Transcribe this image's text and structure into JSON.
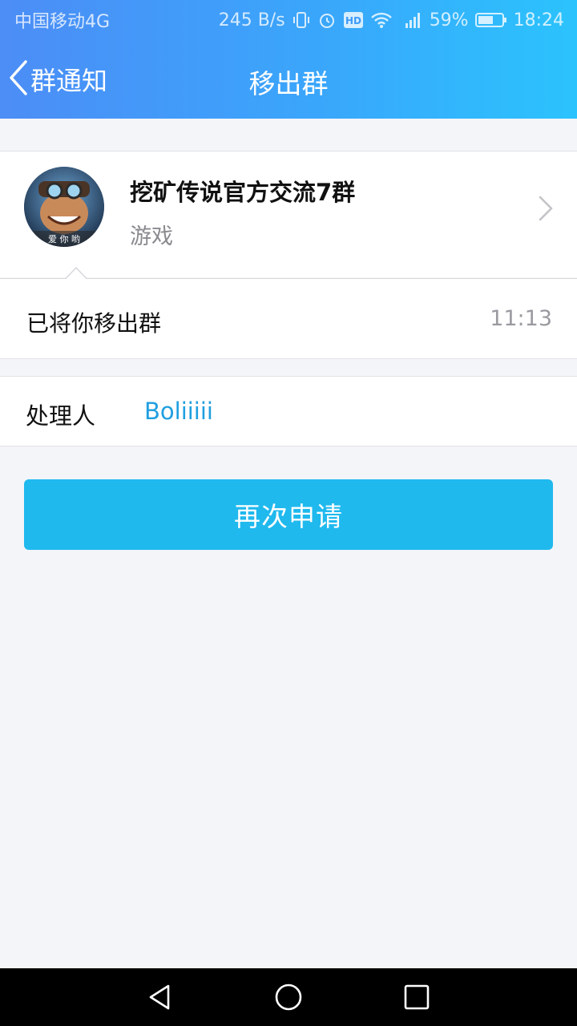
{
  "status_bar": {
    "carrier": "中国移动4G",
    "net_speed": "245 B/s",
    "battery": "59%",
    "time": "18:24",
    "icons": [
      "vibrate-icon",
      "alarm-icon",
      "hd-icon",
      "wifi-icon",
      "signal-4g-icon",
      "battery-icon"
    ]
  },
  "nav": {
    "back_label": "群通知",
    "title": "移出群"
  },
  "group": {
    "name": "挖矿传说官方交流7群",
    "category": "游戏",
    "avatar_caption": "爱 你 哟"
  },
  "message": {
    "text": "已将你移出群",
    "time": "11:13"
  },
  "handler": {
    "label": "处理人",
    "name": "Boliiiii"
  },
  "action": {
    "reapply_label": "再次申请"
  },
  "colors": {
    "header_start": "#4c8df6",
    "header_end": "#2bc3fd",
    "button": "#1fb9ee",
    "link": "#1f9fe0",
    "background": "#f4f5f9"
  }
}
